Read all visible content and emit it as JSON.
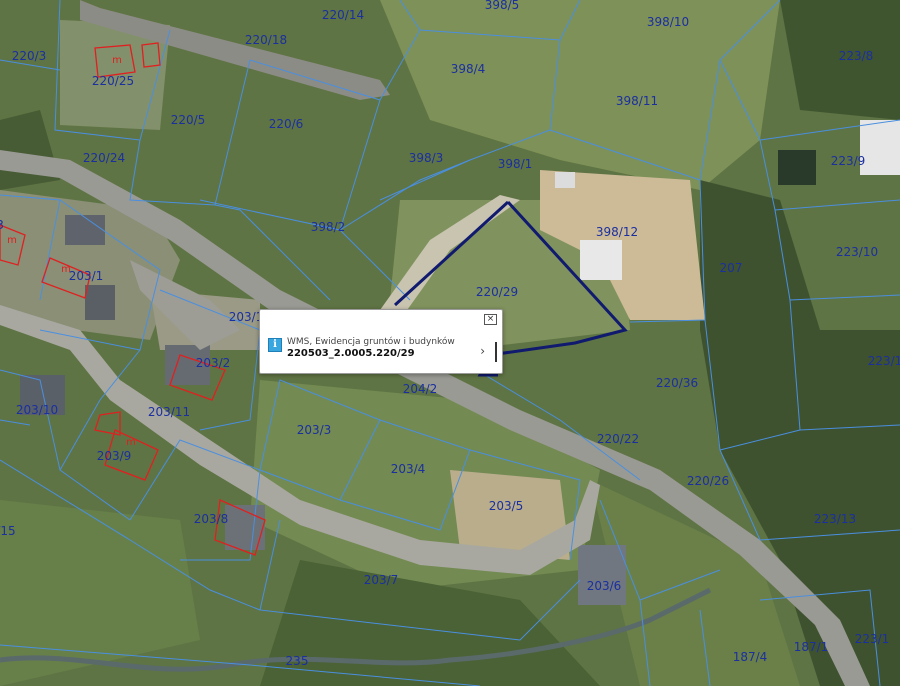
{
  "map": {
    "parcel_labels": [
      {
        "text": "220/14"
      },
      {
        "text": "398/5"
      },
      {
        "text": "398/10"
      },
      {
        "text": "220/3"
      },
      {
        "text": "220/18"
      },
      {
        "text": "398/4"
      },
      {
        "text": "223/8"
      },
      {
        "text": "220/25"
      },
      {
        "text": "398/11"
      },
      {
        "text": "220/5"
      },
      {
        "text": "220/6"
      },
      {
        "text": "220/24"
      },
      {
        "text": "398/3"
      },
      {
        "text": "398/1"
      },
      {
        "text": "223/9"
      },
      {
        "text": "398/2"
      },
      {
        "text": "398/12"
      },
      {
        "text": "223/10"
      },
      {
        "text": "3"
      },
      {
        "text": "203/1"
      },
      {
        "text": "220/29"
      },
      {
        "text": "207"
      },
      {
        "text": "203/1"
      },
      {
        "text": "223/1"
      },
      {
        "text": "203/2"
      },
      {
        "text": "204/2"
      },
      {
        "text": "220/36"
      },
      {
        "text": "203/10"
      },
      {
        "text": "203/11"
      },
      {
        "text": "203/3"
      },
      {
        "text": "220/22"
      },
      {
        "text": "203/9"
      },
      {
        "text": "203/4"
      },
      {
        "text": "220/26"
      },
      {
        "text": "223/13"
      },
      {
        "text": "203/8"
      },
      {
        "text": "203/5"
      },
      {
        "text": "/15"
      },
      {
        "text": "203/7"
      },
      {
        "text": "203/6"
      },
      {
        "text": "223/1"
      },
      {
        "text": "187/1"
      },
      {
        "text": "187/4"
      },
      {
        "text": "235"
      }
    ],
    "building_marks": [
      {
        "text": "m"
      },
      {
        "text": "m"
      },
      {
        "text": "m"
      },
      {
        "text": "m"
      }
    ],
    "colors": {
      "parcel_line": "#4a8fe0",
      "label": "#1b2fa0",
      "highlight": "#101a6e",
      "building": "#e02020",
      "road": "#8a8a80"
    }
  },
  "popup": {
    "close_glyph": "×",
    "info_glyph": "i",
    "layer_name": "WMS, Ewidencja gruntów i budynków",
    "parcel_id": "220503_2.0005.220/29",
    "expand_glyph": "›"
  }
}
